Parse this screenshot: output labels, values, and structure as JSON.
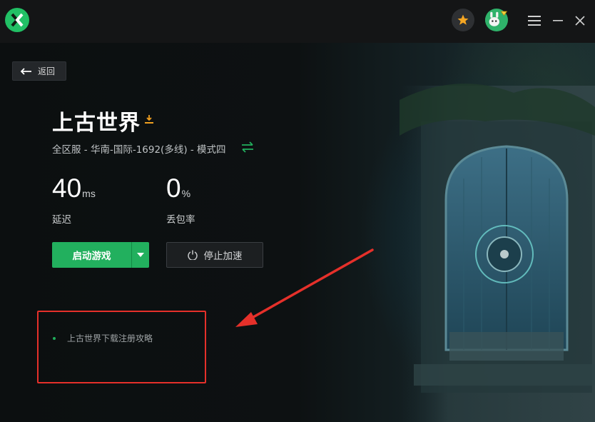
{
  "titlebar": {
    "logo_icon": "brand-logo-icon",
    "favorite_icon": "star-icon",
    "avatar_icon": "avatar",
    "menu_icon": "hamburger-menu-icon",
    "minimize_icon": "minimize-icon",
    "close_icon": "close-icon"
  },
  "back": {
    "label": "返回"
  },
  "game": {
    "title": "上古世界",
    "server": "全区服 - 华南-国际-1692(多线) - 模式四"
  },
  "stats": {
    "latency_value": "40",
    "latency_unit": "ms",
    "latency_label": "延迟",
    "loss_value": "0",
    "loss_unit": "%",
    "loss_label": "丢包率"
  },
  "actions": {
    "start_label": "启动游戏",
    "stop_label": "停止加速"
  },
  "guides": [
    {
      "label": "上古世界下载注册攻略"
    }
  ],
  "colors": {
    "accent_green": "#22b05e",
    "annotation_red": "#e5302a",
    "background": "#0b0e0f"
  }
}
